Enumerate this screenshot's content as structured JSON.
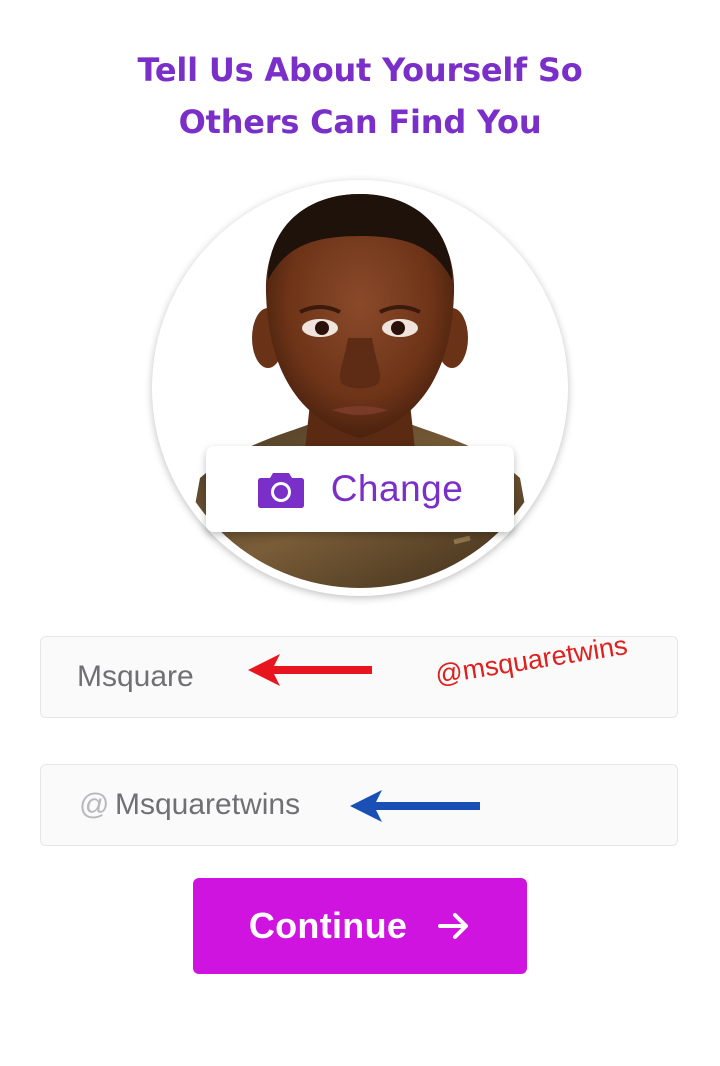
{
  "header": {
    "title_line1": "Tell Us About Yourself So",
    "title_line2": "Others Can Find You"
  },
  "profile": {
    "change_photo_label": "Change",
    "change_icon": "camera-icon"
  },
  "form": {
    "name_value": "Msquare",
    "username_prefix": "@",
    "username_value": "Msquaretwins"
  },
  "annotations": {
    "watermark": "@msquaretwins",
    "red_arrow_color": "#e8141e",
    "blue_arrow_color": "#1a4fb5"
  },
  "actions": {
    "continue_label": "Continue",
    "continue_icon": "arrow-right-icon"
  },
  "colors": {
    "title_purple": "#7a2fc8",
    "button_magenta": "#cf14e0"
  }
}
